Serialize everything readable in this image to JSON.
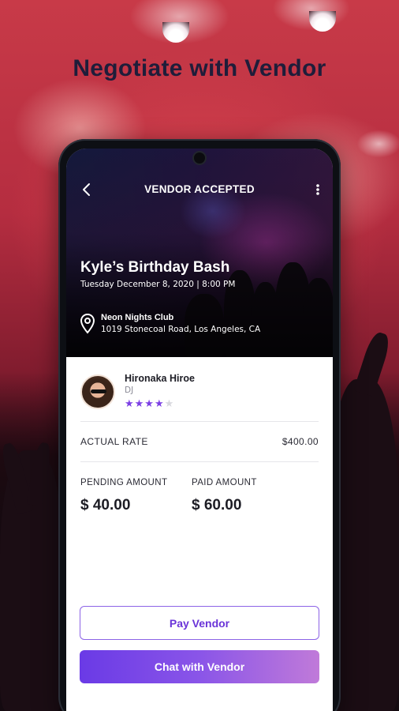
{
  "headline": "Negotiate with Vendor",
  "header": {
    "title": "VENDOR ACCEPTED"
  },
  "event": {
    "title": "Kyle’s Birthday Bash",
    "date": "Tuesday December 8, 2020  |  8:00 PM",
    "venue_name": "Neon Nights Club",
    "venue_address": "1019 Stonecoal Road, Los Angeles, CA"
  },
  "vendor": {
    "name": "Hironaka Hiroe",
    "role": "DJ",
    "rating": 4,
    "rating_max": 5,
    "stars_on": "★★★★",
    "stars_off": "★"
  },
  "rate": {
    "label": "ACTUAL RATE",
    "value": "$400.00"
  },
  "pending": {
    "label": "PENDING AMOUNT",
    "value": "$ 40.00"
  },
  "paid": {
    "label": "PAID AMOUNT",
    "value": "$ 60.00"
  },
  "actions": {
    "pay": "Pay Vendor",
    "chat": "Chat with Vendor"
  },
  "colors": {
    "accent": "#7b3fe4",
    "headline": "#1f1d3a"
  }
}
